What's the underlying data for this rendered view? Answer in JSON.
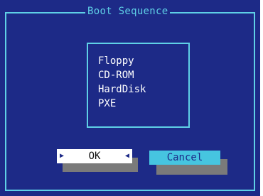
{
  "dialog": {
    "title": "Boot Sequence"
  },
  "boot_list": {
    "items": [
      "Floppy",
      "CD-ROM",
      "HardDisk",
      "PXE"
    ]
  },
  "buttons": {
    "ok_label": "OK",
    "cancel_label": "Cancel"
  },
  "colors": {
    "background": "#1d2a87",
    "accent": "#5fd0e6",
    "ok_button": "#ffffff",
    "cancel_button": "#46c5e0",
    "button_shadow": "#7a7a7a"
  },
  "icons": {
    "ok_left": "triangle-right-icon",
    "ok_right": "triangle-left-icon"
  }
}
